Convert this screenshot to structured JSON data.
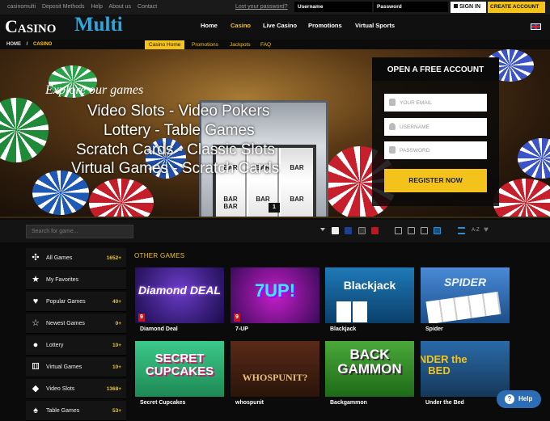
{
  "topbar": {
    "links": [
      "casinomulti",
      "Deposit Methods",
      "Help",
      "About us",
      "Contact"
    ],
    "lost_password": "Lost your password?",
    "username_label": "Username",
    "password_label": "Password",
    "signin_label": "SIGN IN",
    "create_label": "CREATE ACCOUNT"
  },
  "logo": {
    "part1": "Casino",
    "part2": "Multi"
  },
  "nav": [
    "Home",
    "Casino",
    "Live Casino",
    "Promotions",
    "Virtual Sports"
  ],
  "breadcrumb": {
    "home": "HOME",
    "sep": "/",
    "current": "CASINO"
  },
  "subnav": [
    "Casino Home",
    "Promotions",
    "Jackpots",
    "FAQ"
  ],
  "hero": {
    "explore": "Explore our games",
    "lines": [
      "Video Slots - Video Pokers",
      "Lottery - Table Games",
      "Scratch Cards - Classic Slots",
      "Virtual Games - Scratch Cards"
    ],
    "slot_labels": [
      "BAR",
      "BAR",
      "BAR",
      "BAR BAR",
      "BAR",
      "BAR"
    ],
    "page": "1"
  },
  "signup": {
    "title": "OPEN A FREE ACCOUNT",
    "email_placeholder": "YOUR EMAIL",
    "username_placeholder": "USERNAME",
    "password_placeholder": "PASSWORD",
    "register_label": "REGISTER NOW"
  },
  "filter": {
    "search_placeholder": "Search for game...",
    "az_label": "A-Z"
  },
  "sidebar": [
    {
      "label": "All Games",
      "count": "1652+",
      "icon": "gamepad-icon"
    },
    {
      "label": "My Favorites",
      "count": "",
      "icon": "star-icon"
    },
    {
      "label": "Popular Games",
      "count": "40+",
      "icon": "heart-icon"
    },
    {
      "label": "Newest Games",
      "count": "0+",
      "icon": "star-outline-icon"
    },
    {
      "label": "Lottery",
      "count": "10+",
      "icon": "lottery-ball-icon"
    },
    {
      "label": "Virtual Games",
      "count": "10+",
      "icon": "dice-icon"
    },
    {
      "label": "Video Slots",
      "count": "1368+",
      "icon": "diamond-icon"
    },
    {
      "label": "Table Games",
      "count": "53+",
      "icon": "cards-icon"
    }
  ],
  "other_games_title": "OTHER GAMES",
  "games": [
    {
      "name": "Diamond Deal",
      "art": "Diamond DEAL",
      "badge": "9"
    },
    {
      "name": "7-UP",
      "art": "7UP!",
      "badge": "9"
    },
    {
      "name": "Blackjack",
      "art": "Blackjack",
      "badge": ""
    },
    {
      "name": "Spider",
      "art": "SPIDER",
      "badge": ""
    },
    {
      "name": "Secret Cupcakes",
      "art": "SECRET CUPCAKES",
      "badge": ""
    },
    {
      "name": "whospunit",
      "art": "WHOSPUNIT?",
      "badge": ""
    },
    {
      "name": "Backgammon",
      "art": "BACK GAMMON",
      "badge": ""
    },
    {
      "name": "Under the Bed",
      "art": "UNDER the BED",
      "badge": ""
    }
  ],
  "help_label": "Help",
  "colors": {
    "accent": "#f3c31b",
    "brand_blue": "#29a9e1",
    "help_blue": "#2d6db5"
  }
}
